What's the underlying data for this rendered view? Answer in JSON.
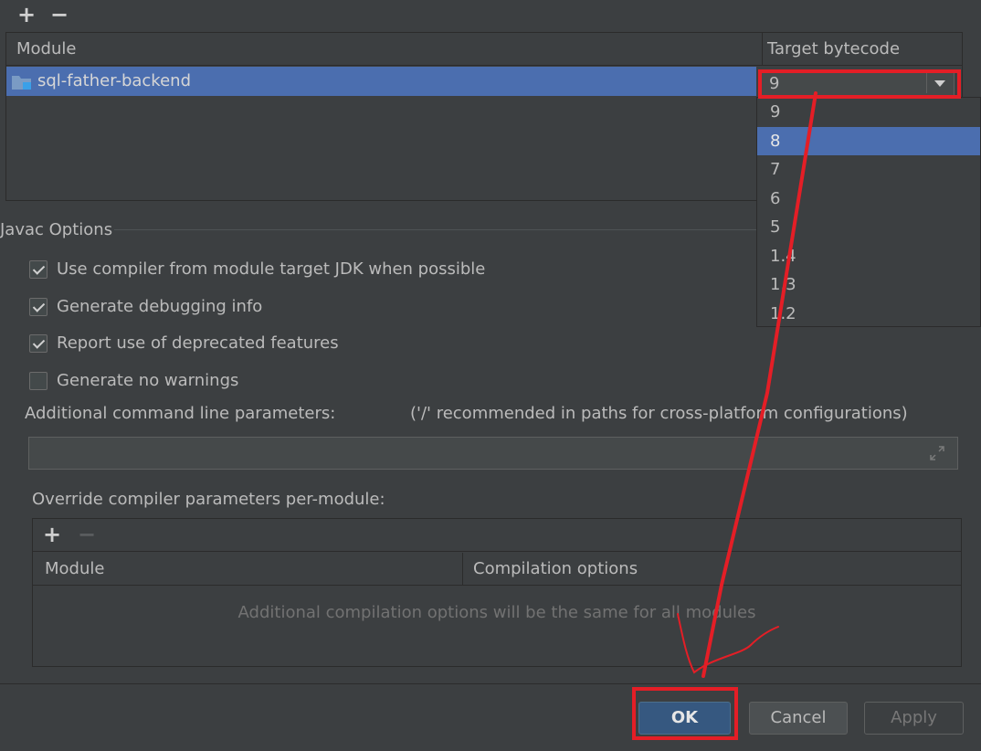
{
  "module_table": {
    "add_label": "+",
    "remove_label": "−",
    "col_module": "Module",
    "col_target": "Target bytecode version",
    "rows": [
      {
        "module": "sql-father-backend",
        "target": "9"
      }
    ]
  },
  "dropdown": {
    "options": [
      "9",
      "8",
      "7",
      "6",
      "5",
      "1.4",
      "1.3",
      "1.2"
    ],
    "selected": "8"
  },
  "javac": {
    "title": "Javac Options",
    "options": [
      {
        "label": "Use compiler from module target JDK when possible",
        "checked": true
      },
      {
        "label": "Generate debugging info",
        "checked": true
      },
      {
        "label": "Report use of deprecated features",
        "checked": true
      },
      {
        "label": "Generate no warnings",
        "checked": false
      }
    ],
    "additional_label": "Additional command line parameters:",
    "additional_hint": "('/' recommended in paths for cross-platform configurations)",
    "additional_value": ""
  },
  "override": {
    "label": "Override compiler parameters per-module:",
    "add_label": "+",
    "remove_label": "−",
    "col_module": "Module",
    "col_options": "Compilation options",
    "empty_text": "Additional compilation options will be the same for all modules"
  },
  "footer": {
    "ok": "OK",
    "cancel": "Cancel",
    "apply": "Apply"
  },
  "colors": {
    "background": "#3c3f41",
    "selection": "#4b6eaf",
    "annotation": "#e41e26"
  }
}
